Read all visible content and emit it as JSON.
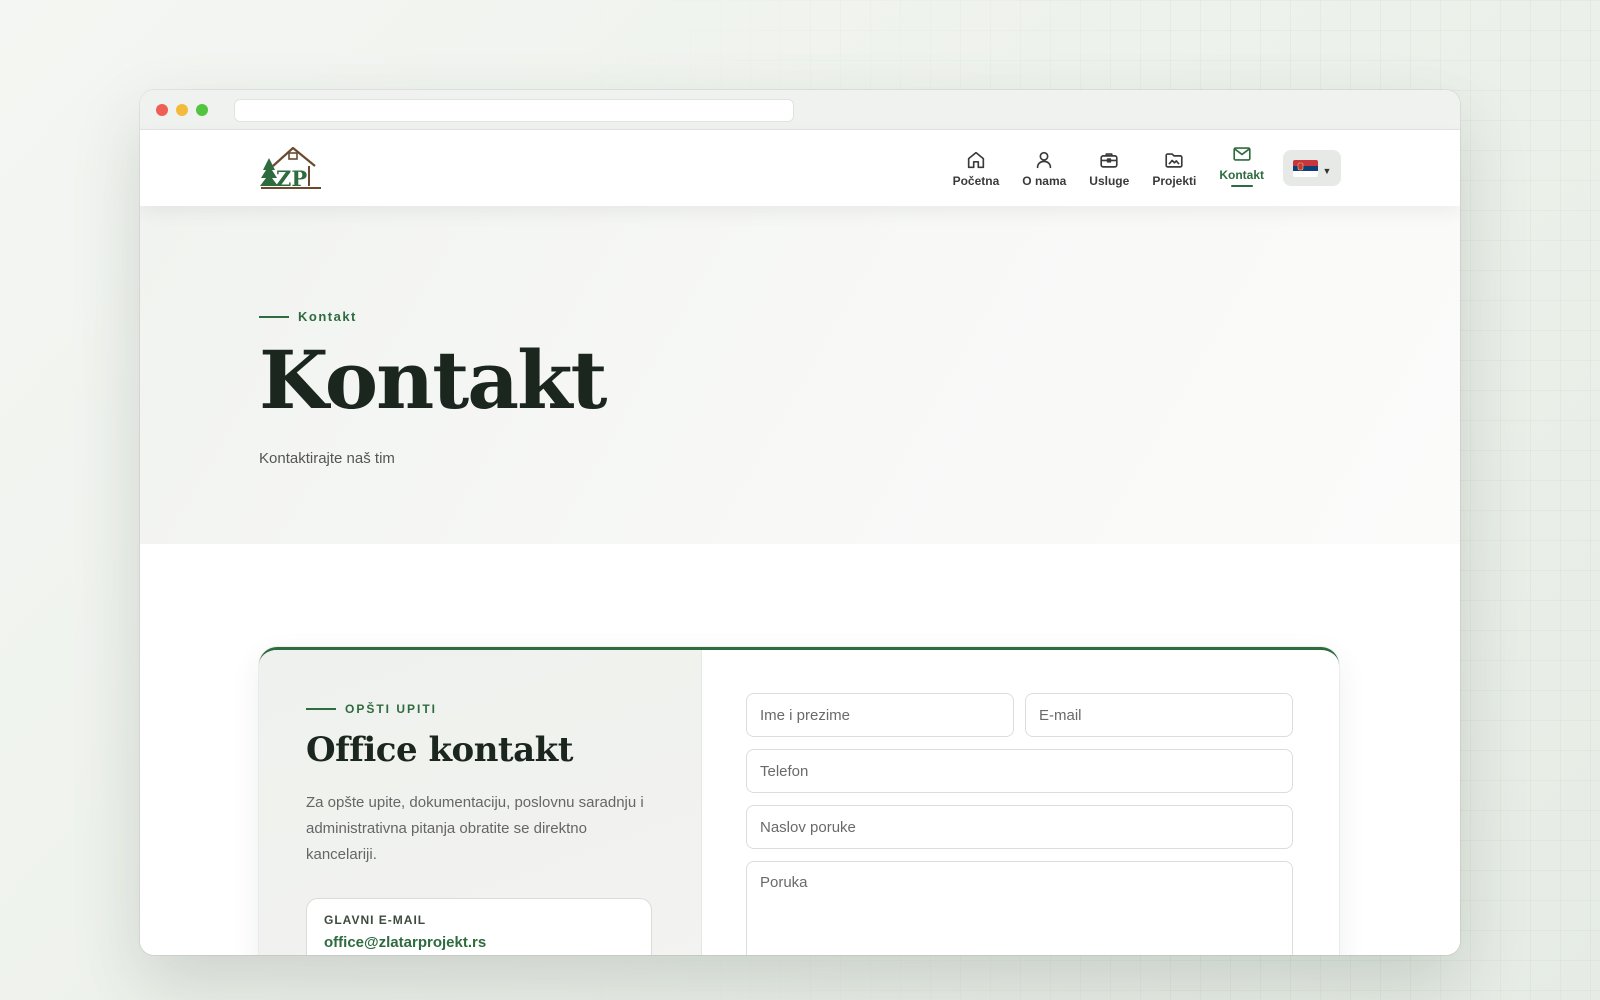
{
  "nav": {
    "items": [
      {
        "label": "Početna",
        "icon": "home-icon"
      },
      {
        "label": "O nama",
        "icon": "user-icon"
      },
      {
        "label": "Usluge",
        "icon": "briefcase-icon"
      },
      {
        "label": "Projekti",
        "icon": "image-folder-icon"
      },
      {
        "label": "Kontakt",
        "icon": "mail-icon",
        "active": true
      }
    ],
    "language": {
      "selected": "sr",
      "flag": "serbia-flag-icon"
    }
  },
  "logo": {
    "text": "ZP"
  },
  "hero": {
    "eyebrow": "Kontakt",
    "title": "Kontakt",
    "subtitle": "Kontaktirajte naš tim"
  },
  "contact_card": {
    "eyebrow": "OPŠTI UPITI",
    "title": "Office kontakt",
    "description": "Za opšte upite, dokumentaciju, poslovnu saradnju i administrativna pitanja obratite se direktno kancelariji.",
    "email_label": "GLAVNI E-MAIL",
    "email_value": "office@zlatarprojekt.rs"
  },
  "form": {
    "name_placeholder": "Ime i prezime",
    "email_placeholder": "E-mail",
    "phone_placeholder": "Telefon",
    "subject_placeholder": "Naslov poruke",
    "message_placeholder": "Poruka"
  },
  "colors": {
    "accent": "#2e6b3f",
    "heading": "#1b261e"
  }
}
